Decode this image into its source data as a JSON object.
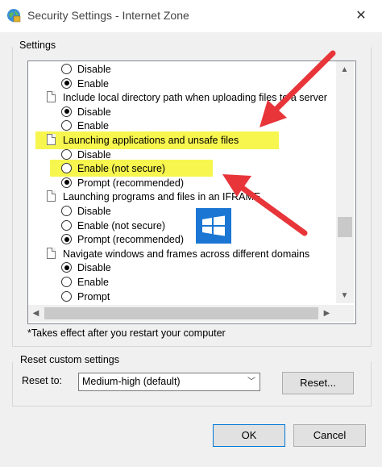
{
  "window": {
    "title": "Security Settings - Internet Zone",
    "close_glyph": "✕"
  },
  "settings": {
    "group_label": "Settings",
    "items": [
      {
        "type": "radio",
        "label": "Disable",
        "checked": false
      },
      {
        "type": "radio",
        "label": "Enable",
        "checked": true
      },
      {
        "type": "header",
        "label": "Include local directory path when uploading files to a server"
      },
      {
        "type": "radio",
        "label": "Disable",
        "checked": true
      },
      {
        "type": "radio",
        "label": "Enable",
        "checked": false
      },
      {
        "type": "header",
        "label": "Launching applications and unsafe files"
      },
      {
        "type": "radio",
        "label": "Disable",
        "checked": false
      },
      {
        "type": "radio",
        "label": "Enable (not secure)",
        "checked": false
      },
      {
        "type": "radio",
        "label": "Prompt (recommended)",
        "checked": true
      },
      {
        "type": "header",
        "label": "Launching programs and files in an IFRAME"
      },
      {
        "type": "radio",
        "label": "Disable",
        "checked": false
      },
      {
        "type": "radio",
        "label": "Enable (not secure)",
        "checked": false
      },
      {
        "type": "radio",
        "label": "Prompt (recommended)",
        "checked": true
      },
      {
        "type": "header",
        "label": "Navigate windows and frames across different domains"
      },
      {
        "type": "radio",
        "label": "Disable",
        "checked": true
      },
      {
        "type": "radio",
        "label": "Enable",
        "checked": false
      },
      {
        "type": "radio",
        "label": "Prompt",
        "checked": false
      }
    ],
    "note": "*Takes effect after you restart your computer"
  },
  "reset": {
    "group_label": "Reset custom settings",
    "reset_to_label": "Reset to:",
    "selected": "Medium-high (default)",
    "reset_button": "Reset..."
  },
  "buttons": {
    "ok": "OK",
    "cancel": "Cancel"
  },
  "colors": {
    "highlight": "#f7f64f",
    "arrow": "#e8353a",
    "accent": "#0078d7"
  }
}
